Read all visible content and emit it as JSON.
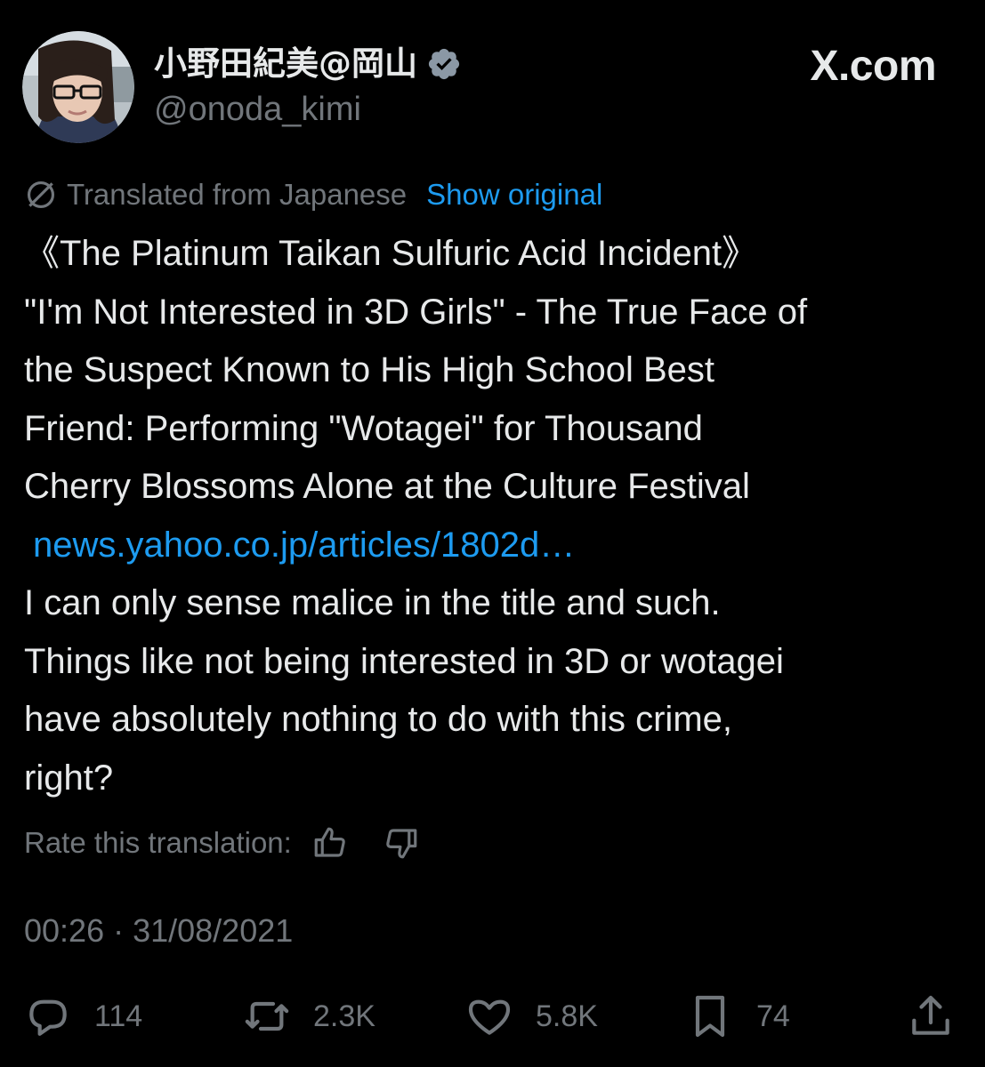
{
  "author": {
    "display_name": "小野田紀美@岡山",
    "handle": "@onoda_kimi",
    "verified": true
  },
  "brand": {
    "text": "X.com"
  },
  "translation": {
    "label": "Translated from Japanese",
    "show_original": "Show original"
  },
  "tweet": {
    "lines": [
      "《The Platinum Taikan Sulfuric Acid Incident》",
      "\"I'm Not Interested in 3D Girls\" - The True Face of",
      "the Suspect Known to His High School Best",
      "Friend: Performing \"Wotagei\" for Thousand",
      "Cherry Blossoms Alone at the Culture Festival"
    ],
    "link": "news.yahoo.co.jp/articles/1802d…",
    "comment_lines": [
      "I can only sense malice in the title and such.",
      "Things like not being interested in 3D or wotagei",
      "have absolutely nothing to do with this crime,",
      "right?"
    ]
  },
  "rate": {
    "label": "Rate this translation:"
  },
  "timestamp": "00:26 · 31/08/2021",
  "actions": {
    "replies": "114",
    "reposts": "2.3K",
    "likes": "5.8K",
    "bookmarks": "74"
  },
  "icons": {
    "verified": "verified-badge-icon",
    "globe": "globe-slash-icon",
    "thumbs_up": "thumbs-up-icon",
    "thumbs_down": "thumbs-down-icon",
    "reply": "reply-icon",
    "repost": "repost-icon",
    "like": "heart-icon",
    "bookmark": "bookmark-icon",
    "share": "share-icon"
  },
  "colors": {
    "background": "#000000",
    "text": "#e7e9ea",
    "muted": "#71767b",
    "link": "#1d9bf0"
  }
}
